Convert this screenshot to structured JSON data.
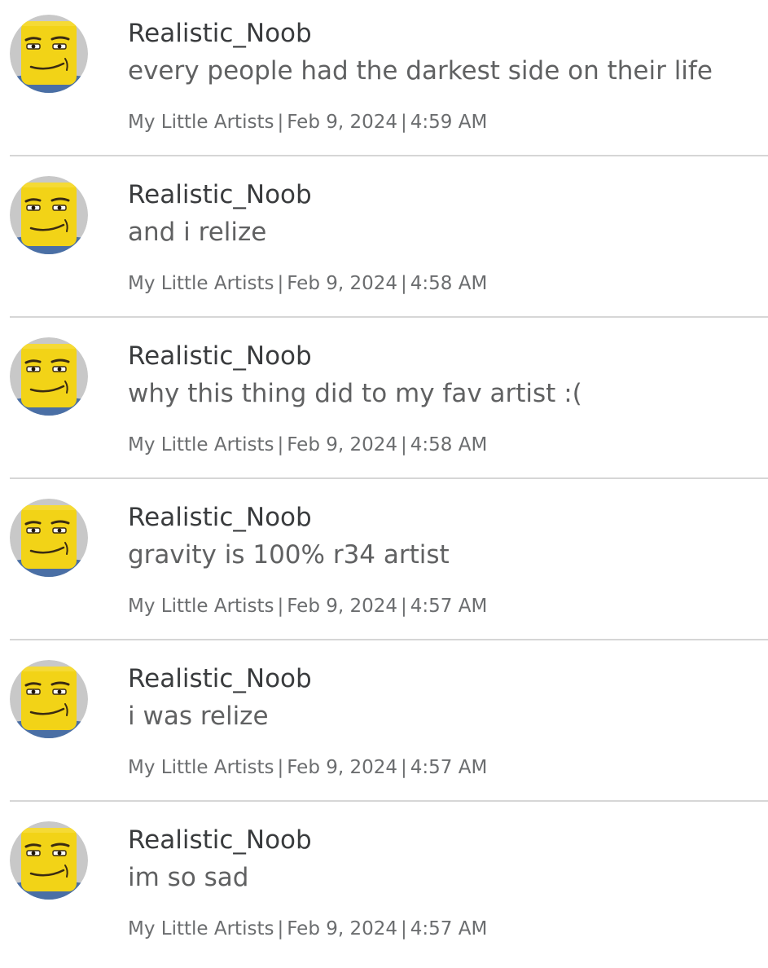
{
  "comments": [
    {
      "username": "Realistic_Noob",
      "message": "every people had the darkest side on their life",
      "group": "My Little Artists",
      "separator": "|",
      "date": "Feb 9, 2024",
      "time": "4:59 AM",
      "avatar_icon": "roblox-man-face-avatar-icon"
    },
    {
      "username": "Realistic_Noob",
      "message": "and i relize",
      "group": "My Little Artists",
      "separator": "|",
      "date": "Feb 9, 2024",
      "time": "4:58 AM",
      "avatar_icon": "roblox-man-face-avatar-icon"
    },
    {
      "username": "Realistic_Noob",
      "message": "why this thing did to my fav artist :(",
      "group": "My Little Artists",
      "separator": "|",
      "date": "Feb 9, 2024",
      "time": "4:58 AM",
      "avatar_icon": "roblox-man-face-avatar-icon"
    },
    {
      "username": "Realistic_Noob",
      "message": "gravity is 100% r34 artist",
      "group": "My Little Artists",
      "separator": "|",
      "date": "Feb 9, 2024",
      "time": "4:57 AM",
      "avatar_icon": "roblox-man-face-avatar-icon"
    },
    {
      "username": "Realistic_Noob",
      "message": "i was relize",
      "group": "My Little Artists",
      "separator": "|",
      "date": "Feb 9, 2024",
      "time": "4:57 AM",
      "avatar_icon": "roblox-man-face-avatar-icon"
    },
    {
      "username": "Realistic_Noob",
      "message": "im so sad",
      "group": "My Little Artists",
      "separator": "|",
      "date": "Feb 9, 2024",
      "time": "4:57 AM",
      "avatar_icon": "roblox-man-face-avatar-icon"
    }
  ],
  "colors": {
    "avatar_background": "#c8c8c8",
    "face_yellow": "#f2d317",
    "shirt_blue": "#4a6fa5",
    "username_text": "#393b3d",
    "message_text": "#606162",
    "meta_text": "#6b6d6f",
    "divider": "#d6d6d6"
  }
}
